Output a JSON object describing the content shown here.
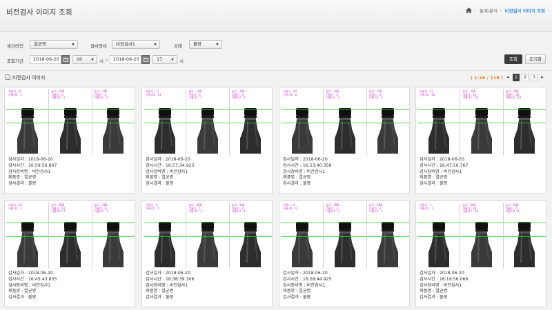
{
  "header": {
    "title": "비전검사 이미지 조회",
    "breadcrumb": [
      "통계/분석",
      "비전검사 이미지 조회"
    ]
  },
  "filters": {
    "line_label": "생산라인",
    "line_value": "열균병",
    "equip_label": "검사장비",
    "equip_value": "비전검사1",
    "status_label": "상태",
    "status_value": "불량",
    "period_label": "조회기간",
    "start_date": "2018-06-20",
    "start_hour": "00",
    "hour_unit": "시",
    "tilde": "~",
    "end_date": "2018-06-20",
    "end_hour": "17",
    "search_button": "조회",
    "reset_button": "초기화"
  },
  "section": {
    "title": "비전검사 이미지",
    "pager_range": "( 1-16 / 118 )",
    "pages": [
      "1",
      "2",
      "3"
    ]
  },
  "labels": {
    "date": "검사일자 :",
    "time": "검사시간 :",
    "equip": "검사장비명 :",
    "product": "제품명 :",
    "result": "검사결과 :"
  },
  "cards": [
    {
      "date": "2018-06-20",
      "time": "16:59:56.807",
      "equip": "비전검사1",
      "product": "열균병",
      "result": "불량",
      "marks": [
        [
          "기울기 : 41",
          "기울기2 : 1"
        ],
        [
          "높이 : 288",
          "기울기 : 3",
          "기울기2 : 2"
        ],
        [
          "높이 : 288",
          "기울기 : 2",
          "기울기2 : 2"
        ]
      ]
    },
    {
      "date": "2018-06-20",
      "time": "16:57:34.923",
      "equip": "비전검사1",
      "product": "열균병",
      "result": "불량",
      "marks": [
        [
          "기울기 : 17",
          "기울기2 : 11"
        ],
        [
          "높이 : 288",
          "기울기 : 6",
          "기울기2 : 2"
        ],
        [
          "높이 : 288",
          "기울기 : 3",
          "기울기2 : 4"
        ]
      ]
    },
    {
      "date": "2018-06-20",
      "time": "16:53:40.356",
      "equip": "비전검사1",
      "product": "열균병",
      "result": "불량",
      "marks": [
        [
          "기울기 : 44",
          "기울기2 : 6"
        ],
        [
          "높이 : 288",
          "기울기 : 3",
          "기울기2 : 3"
        ],
        [
          "높이 : 288",
          "기울기 : 3",
          "기울기2 : 3"
        ]
      ]
    },
    {
      "date": "2018-06-20",
      "time": "16:47:50.767",
      "equip": "비전검사1",
      "product": "열균병",
      "result": "불량",
      "marks": [
        [
          "기울기 : 22",
          "기울기2 : 20"
        ],
        [
          "높이 : 288",
          "기울기 : 12",
          "기울기2 : 16"
        ],
        [
          "높이 : 288",
          "기울기 : 10",
          "기울기2 : 14"
        ]
      ]
    },
    {
      "date": "2018-06-20",
      "time": "16:45:43.835",
      "equip": "비전검사1",
      "product": "열균병",
      "result": "불량",
      "marks": [
        [
          "기울기 : 22",
          "기울기2 : 1"
        ],
        [
          "높이 : 288",
          "기울기 : 12",
          "기울기2 : 4"
        ],
        [
          "높이 : 288",
          "기울기 : 8",
          "기울기2 : 7"
        ]
      ]
    },
    {
      "date": "2018-06-20",
      "time": "16:38:39.306",
      "equip": "비전검사1",
      "product": "열균병",
      "result": "불량",
      "marks": [
        [
          "기울기 : 4",
          "기울기2 : 1"
        ],
        [
          "높이 : 288",
          "기울기 : 1",
          "기울기2 : 3"
        ],
        [
          "높이 : 288",
          "기울기 : 4",
          "기울기2 : 4"
        ]
      ]
    },
    {
      "date": "2018-06-20",
      "time": "16:28:44.925",
      "equip": "비전검사1",
      "product": "열균병",
      "result": "불량",
      "marks": [
        [
          "기울기 : 4",
          "기울기2 : 4"
        ],
        [
          "높이 : 288",
          "기울기 : 3",
          "기울기2 : 3"
        ],
        [
          "높이 : 288",
          "기울기 : 3",
          "기울기2 : 3"
        ]
      ]
    },
    {
      "date": "2018-06-20",
      "time": "16:19:56.066",
      "equip": "비전검사1",
      "product": "열균병",
      "result": "불량",
      "marks": [
        [
          "기울기 : 1",
          "기울기2 : 1"
        ],
        [
          "높이 : 288",
          "기울기 : 24",
          "기울기2 : 26"
        ],
        [
          "높이 : 288",
          "기울기 : 5",
          "기울기2 : 4"
        ]
      ]
    }
  ]
}
